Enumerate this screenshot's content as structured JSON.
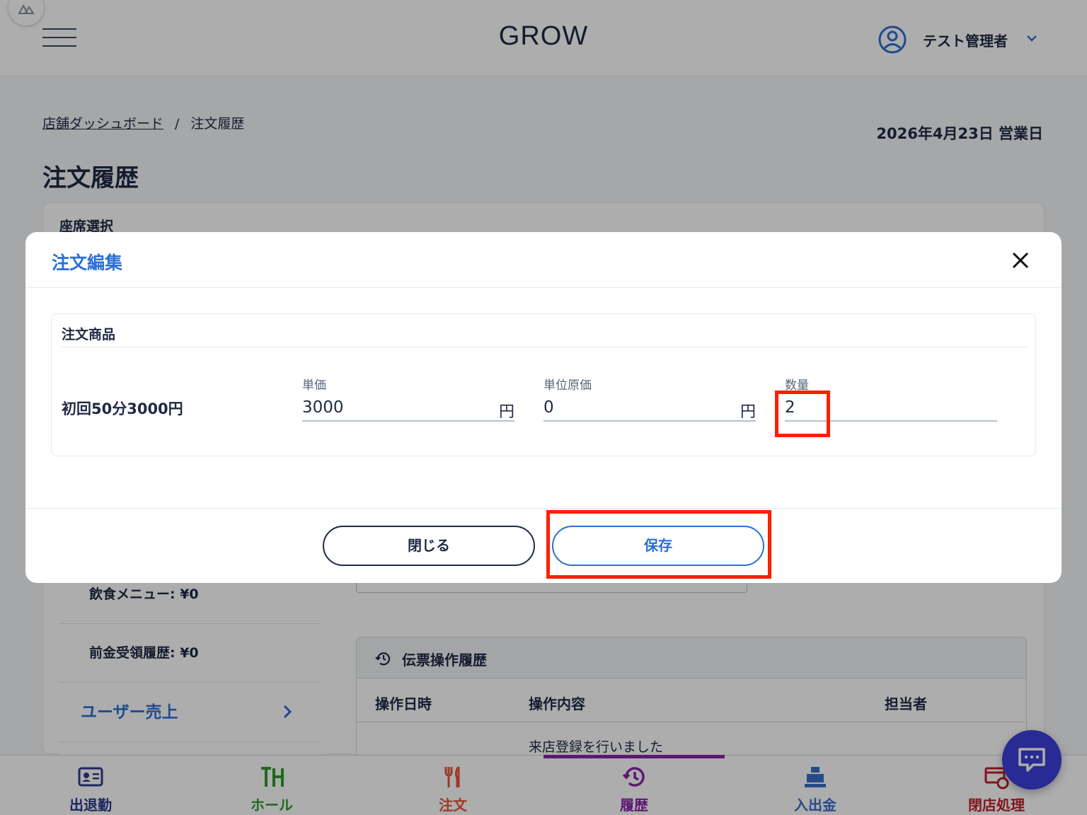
{
  "header": {
    "brand": "GROW",
    "user_name": "テスト管理者"
  },
  "breadcrumb": {
    "parent": "店舗ダッシュボード",
    "separator": "/",
    "current": "注文履歴"
  },
  "business_day": "2026年4月23日 営業日",
  "page_title": "注文履歴",
  "seat_select_label": "座席選択",
  "left_panel": {
    "food_menu": "飲食メニュー: ¥0",
    "deposit_history": "前金受領履歴: ¥0",
    "user_sales": "ユーザー売上"
  },
  "ops_history": {
    "title": "伝票操作履歴",
    "columns": [
      "操作日時",
      "操作内容",
      "担当者"
    ],
    "rows": [
      {
        "time": "",
        "content": "来店登録を行いました",
        "staff": ""
      }
    ]
  },
  "modal": {
    "title": "注文編集",
    "section_label": "注文商品",
    "product_name": "初回50分3000円",
    "fields": {
      "unit_price": {
        "label": "単価",
        "value": "3000",
        "unit": "円"
      },
      "unit_cost": {
        "label": "単位原価",
        "value": "0",
        "unit": "円"
      },
      "quantity": {
        "label": "数量",
        "value": "2"
      }
    },
    "close_label": "閉じる",
    "save_label": "保存"
  },
  "tabs": [
    {
      "label": "出退勤",
      "icon": "id-card-icon",
      "color": "#2b3a8c"
    },
    {
      "label": "ホール",
      "icon": "table-icon",
      "color": "#2e9b2e"
    },
    {
      "label": "注文",
      "icon": "cutlery-icon",
      "color": "#e8553d"
    },
    {
      "label": "履歴",
      "icon": "history-icon",
      "color": "#8a24a8",
      "active": true
    },
    {
      "label": "入出金",
      "icon": "cash-register-icon",
      "color": "#3b6fc9"
    },
    {
      "label": "閉店処理",
      "icon": "shop-close-icon",
      "color": "#c0202a"
    }
  ],
  "colors": {
    "accent": "#2b6fd6",
    "highlight": "#ff1f00",
    "active_tab": "#8a24a8"
  }
}
